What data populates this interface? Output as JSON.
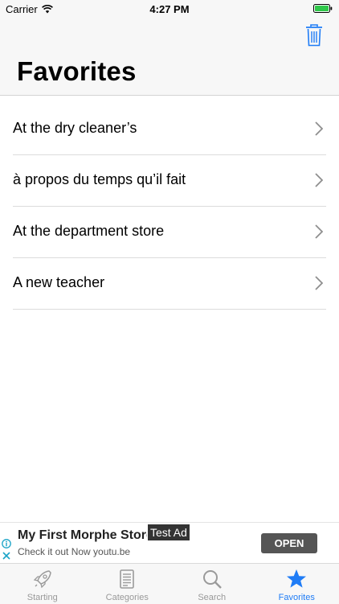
{
  "status_bar": {
    "carrier": "Carrier",
    "time": "4:27 PM"
  },
  "header": {
    "title": "Favorites",
    "trash_icon": "trash-icon"
  },
  "favorites": [
    {
      "label": "At the dry cleaner’s"
    },
    {
      "label": "à propos du temps qu’il fait"
    },
    {
      "label": "At the department store"
    },
    {
      "label": "A new teacher"
    }
  ],
  "ad": {
    "title": "My First Morphe Store",
    "tag": "Test Ad",
    "subtitle": "Check it out Now youtu.be",
    "button": "OPEN"
  },
  "tabs": [
    {
      "label": "Starting",
      "icon": "rocket-icon",
      "active": false
    },
    {
      "label": "Categories",
      "icon": "document-icon",
      "active": false
    },
    {
      "label": "Search",
      "icon": "search-icon",
      "active": false
    },
    {
      "label": "Favorites",
      "icon": "star-icon",
      "active": true
    }
  ],
  "colors": {
    "accent": "#1f7cf6",
    "tab_inactive": "#999999",
    "header_bg": "#f7f7f7"
  }
}
